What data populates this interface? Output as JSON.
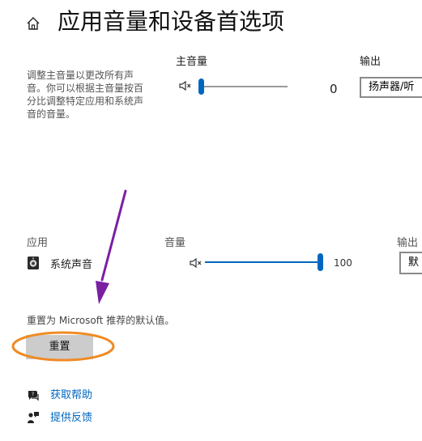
{
  "header": {
    "title": "应用音量和设备首选项",
    "home_icon": "home-icon"
  },
  "master": {
    "description": "调整主音量以更改所有声\n音。你可以根据主音量按百\n分比调整特定应用和系统声\n音的音量。",
    "volume_label": "主音量",
    "volume_value": "0",
    "volume_fraction": 0,
    "speaker_icon": "speaker-muted-icon",
    "output_label": "输出",
    "output_value": "扬声器/听"
  },
  "apps": {
    "app_column_label": "应用",
    "volume_column_label": "音量",
    "output_column_label": "输出",
    "rows": [
      {
        "icon": "system-sounds-icon",
        "name": "系统声音",
        "volume_value": "100",
        "volume_fraction": 1,
        "speaker_icon": "speaker-muted-icon",
        "output_value": "默"
      }
    ]
  },
  "reset": {
    "description": "重置为 Microsoft 推荐的默认值。",
    "button_label": "重置"
  },
  "links": {
    "help_label": "获取帮助",
    "help_icon": "help-chat-icon",
    "feedback_label": "提供反馈",
    "feedback_icon": "feedback-icon"
  },
  "colors": {
    "accent": "#0067c0",
    "link": "#0067c0",
    "annotation_arrow": "#7a1fa2",
    "annotation_highlight": "#f08a24",
    "button_bg": "#cccccc"
  }
}
